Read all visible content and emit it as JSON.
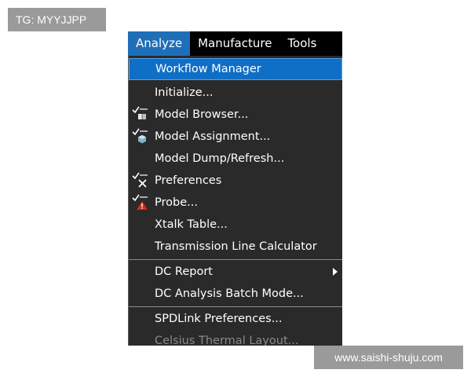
{
  "watermarks": {
    "top_left": "TG: MYYJJPP",
    "bottom_right": "www.saishi-shuju.com"
  },
  "menubar": {
    "items": [
      {
        "label": "Analyze",
        "active": true
      },
      {
        "label": "Manufacture"
      },
      {
        "label": "Tools"
      }
    ]
  },
  "menu": {
    "items": [
      {
        "label": "Workflow Manager"
      },
      {
        "label": "Initialize..."
      },
      {
        "label": "Model Browser...",
        "icon": "model-browser-icon"
      },
      {
        "label": "Model Assignment...",
        "icon": "model-assignment-icon"
      },
      {
        "label": "Model Dump/Refresh..."
      },
      {
        "label": "Preferences",
        "icon": "preferences-icon"
      },
      {
        "label": "Probe...",
        "icon": "probe-warning-icon"
      },
      {
        "label": "Xtalk Table..."
      },
      {
        "label": "Transmission Line Calculator"
      },
      {
        "label": "DC Report",
        "submenu": true
      },
      {
        "label": "DC Analysis Batch Mode..."
      },
      {
        "label": "SPDLink Preferences..."
      },
      {
        "label": "Celsius Thermal Layout...",
        "disabled": true
      }
    ]
  },
  "colors": {
    "menubar_bg": "#000000",
    "active_tab": "#1f6fb8",
    "menu_bg": "#2a2a2a",
    "highlight": "#0f6ec6",
    "disabled_text": "#8a8a8a",
    "warning_red": "#d9261c"
  }
}
